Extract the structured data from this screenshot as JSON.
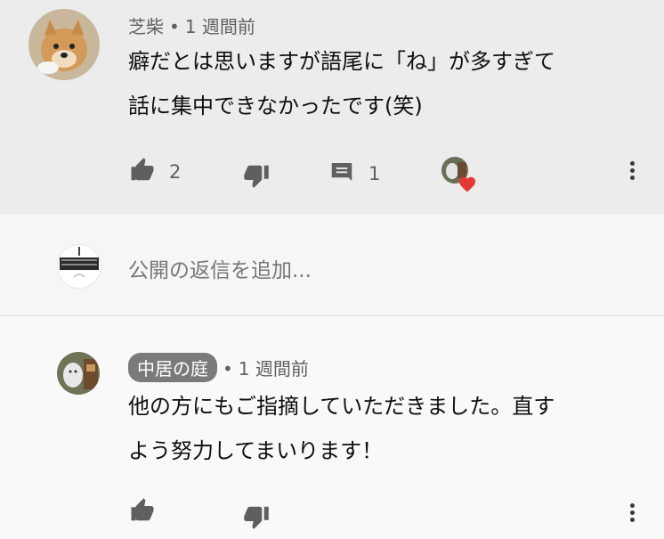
{
  "comment": {
    "author": "芝柴",
    "time": "1 週間前",
    "text_lines": [
      "癖だとは思いますが語尾に「ね」が多すぎて",
      "話に集中できなかったです(笑)"
    ],
    "likes": "2",
    "replies": "1",
    "heart_color": "#e53935"
  },
  "reply_box": {
    "placeholder": "公開の返信を追加..."
  },
  "reply": {
    "author": "中居の庭",
    "time": "1 週間前",
    "text_lines": [
      "他の方にもご指摘していただきました。直す",
      "よう努力してまいります！"
    ]
  },
  "icons": {
    "like": "thumbs-up-icon",
    "dislike": "thumbs-down-icon",
    "reply": "comment-icon",
    "more": "more-vert-icon"
  }
}
